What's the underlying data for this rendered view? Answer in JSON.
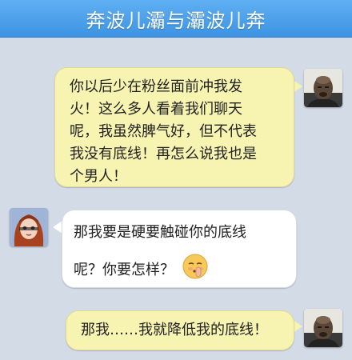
{
  "header": {
    "title": "奔波儿灞与灞波儿奔"
  },
  "messages": [
    {
      "sender": "right",
      "avatar": "bald-man-avatar",
      "text": "你以后少在粉丝面前冲我发\n火！这么多人看着我们聊天\n呢，我虽然脾气好，但不代表\n我没有底线！再怎么说我也是\n个男人！"
    },
    {
      "sender": "left",
      "avatar": "red-hair-girl-avatar",
      "line1": "那我要是硬要触碰你的底线",
      "line2": "呢？你要怎样？",
      "emoji": "shh-face-emoji"
    },
    {
      "sender": "right",
      "avatar": "bald-man-avatar",
      "text": "那我……我就降低我的底线！"
    }
  ],
  "colors": {
    "background": "#d3dbe7",
    "header": "#4aa0ea",
    "bubble_right": "#f7f4b1",
    "bubble_left": "#ffffff"
  }
}
